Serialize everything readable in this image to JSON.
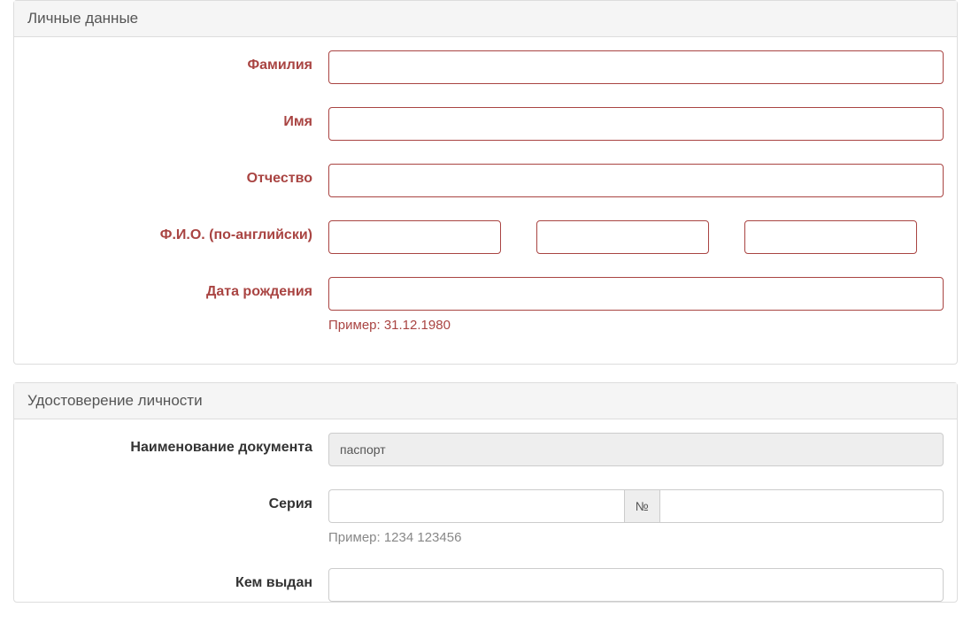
{
  "personal": {
    "title": "Личные данные",
    "fields": {
      "surname": {
        "label": "Фамилия",
        "value": ""
      },
      "name": {
        "label": "Имя",
        "value": ""
      },
      "patronymic": {
        "label": "Отчество",
        "value": ""
      },
      "fio_en": {
        "label": "Ф.И.О. (по-английски)",
        "v1": "",
        "v2": "",
        "v3": ""
      },
      "birthdate": {
        "label": "Дата рождения",
        "value": "",
        "hint": "Пример: 31.12.1980"
      }
    }
  },
  "identity": {
    "title": "Удостоверение личности",
    "fields": {
      "doc_name": {
        "label": "Наименование документа",
        "value": "паспорт"
      },
      "series": {
        "label": "Серия",
        "series_value": "",
        "num_label": "№",
        "num_value": "",
        "hint": "Пример: 1234 123456"
      },
      "issued_by": {
        "label": "Кем выдан",
        "value": ""
      }
    }
  }
}
